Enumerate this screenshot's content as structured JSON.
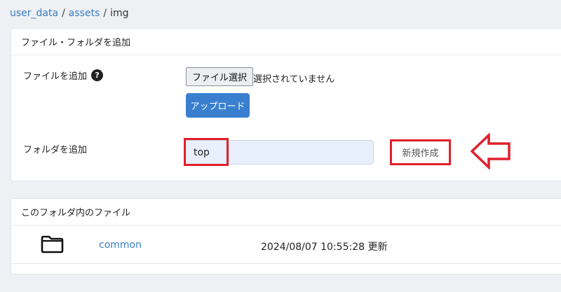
{
  "breadcrumb": {
    "items": [
      "user_data",
      "assets",
      "img"
    ],
    "separator": "/"
  },
  "add_card": {
    "title": "ファイル・フォルダを追加",
    "file_row": {
      "label": "ファイルを追加",
      "help_icon": "?",
      "choose_button": "ファイル選択",
      "status": "選択されていません",
      "upload_button": "アップロード"
    },
    "folder_row": {
      "label": "フォルダを追加",
      "input_value": "top",
      "create_button": "新規作成"
    }
  },
  "files_card": {
    "title": "このフォルダ内のファイル",
    "rows": [
      {
        "icon": "folder-icon",
        "name": "common",
        "date": "2024/08/07 10:55:28 更新"
      }
    ]
  },
  "colors": {
    "accent": "#3a7fcf",
    "link": "#3b7cc4",
    "highlight": "#e0202a",
    "input_bg": "#e8f0fd",
    "page_bg": "#eef0f4"
  }
}
